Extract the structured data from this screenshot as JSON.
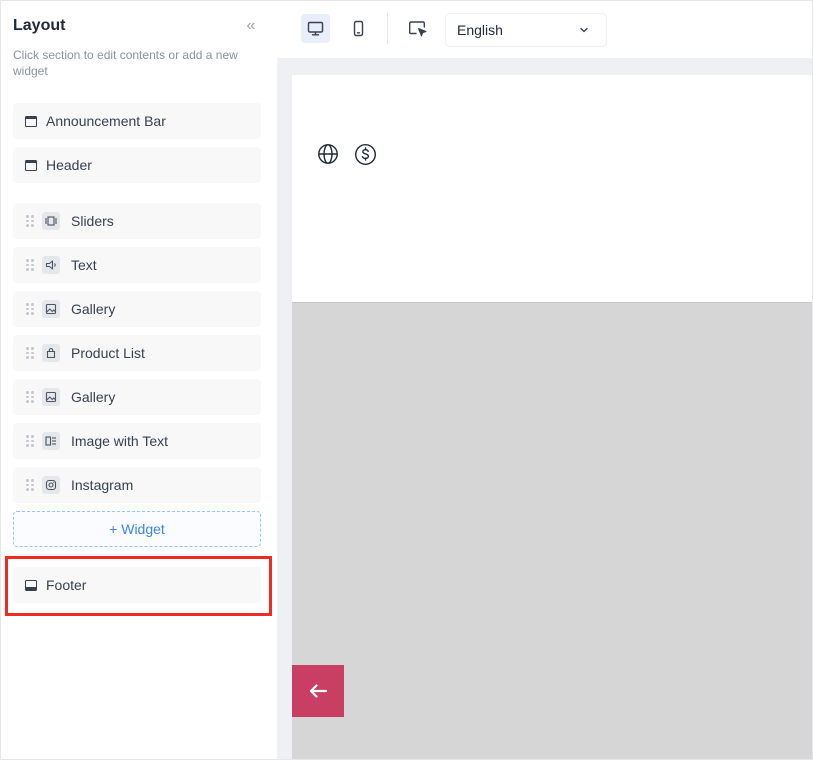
{
  "sidebar": {
    "title": "Layout",
    "collapse_icon": "«",
    "description": "Click section to edit contents or add a new widget",
    "fixed_top": [
      {
        "label": "Announcement Bar",
        "icon": "header-block-icon"
      },
      {
        "label": "Header",
        "icon": "header-block-icon"
      }
    ],
    "widgets": [
      {
        "label": "Sliders",
        "icon": "slider-icon"
      },
      {
        "label": "Text",
        "icon": "text-icon"
      },
      {
        "label": "Gallery",
        "icon": "image-icon"
      },
      {
        "label": "Product List",
        "icon": "shopping-bag-icon"
      },
      {
        "label": "Gallery",
        "icon": "image-icon"
      },
      {
        "label": "Image with Text",
        "icon": "image-text-icon"
      },
      {
        "label": "Instagram",
        "icon": "instagram-icon"
      }
    ],
    "add_widget_label": "+ Widget",
    "footer": {
      "label": "Footer",
      "icon": "footer-block-icon"
    }
  },
  "toolbar": {
    "desktop_icon": "desktop-icon",
    "mobile_icon": "mobile-icon",
    "select_icon": "cursor-select-icon",
    "language": "English"
  },
  "preview": {
    "globe_icon": "globe-icon",
    "currency_icon": "dollar-icon",
    "back_icon": "arrow-left-icon",
    "back_color": "#c93e63"
  },
  "colors": {
    "accent_blue": "#3b82f6",
    "highlight_red": "#ef2b24"
  }
}
